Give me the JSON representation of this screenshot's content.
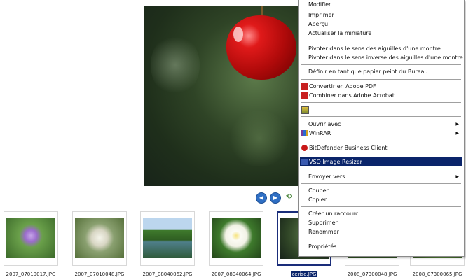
{
  "menu": {
    "items": [
      {
        "label": "Modifier"
      },
      {
        "label": "Imprimer"
      },
      {
        "label": "Aperçu"
      },
      {
        "label": "Actualiser la miniature"
      },
      {
        "label": "Pivoter dans le sens des aiguilles d'une montre"
      },
      {
        "label": "Pivoter dans le sens inverse des aiguilles d'une montre"
      },
      {
        "label": "Définir en tant que papier peint du Bureau"
      },
      {
        "label": "Convertir en Adobe PDF",
        "icon": "adobe-pdf-icon"
      },
      {
        "label": "Combiner dans Adobe Acrobat...",
        "icon": "adobe-acrobat-icon"
      },
      {
        "label": "",
        "icon": "image-tool-icon"
      },
      {
        "label": "Ouvrir avec",
        "submenu": true
      },
      {
        "label": "WinRAR",
        "icon": "winrar-icon",
        "submenu": true
      },
      {
        "label": "BitDefender Business Client",
        "icon": "bitdefender-icon"
      },
      {
        "label": "VSO Image Resizer",
        "icon": "vso-icon",
        "highlighted": true
      },
      {
        "label": "Envoyer vers",
        "submenu": true
      },
      {
        "label": "Couper"
      },
      {
        "label": "Copier"
      },
      {
        "label": "Créer un raccourci"
      },
      {
        "label": "Supprimer"
      },
      {
        "label": "Renommer"
      },
      {
        "label": "Propriétés"
      }
    ],
    "highlight_color": "#0a246a"
  },
  "viewer": {
    "nav_prev_icon": "previous-image-icon",
    "nav_next_icon": "next-image-icon",
    "rotate_icon": "rotate-icon"
  },
  "thumbnails": [
    {
      "label": "2007_07010017.JPG"
    },
    {
      "label": "2007_07010048.JPG"
    },
    {
      "label": "2007_08040062.JPG"
    },
    {
      "label": "2007_08040064.JPG"
    },
    {
      "label": "cerise.JPG",
      "selected": true
    },
    {
      "label": "2008_07300048.JPG"
    },
    {
      "label": "2008_07300065.JPG"
    }
  ]
}
